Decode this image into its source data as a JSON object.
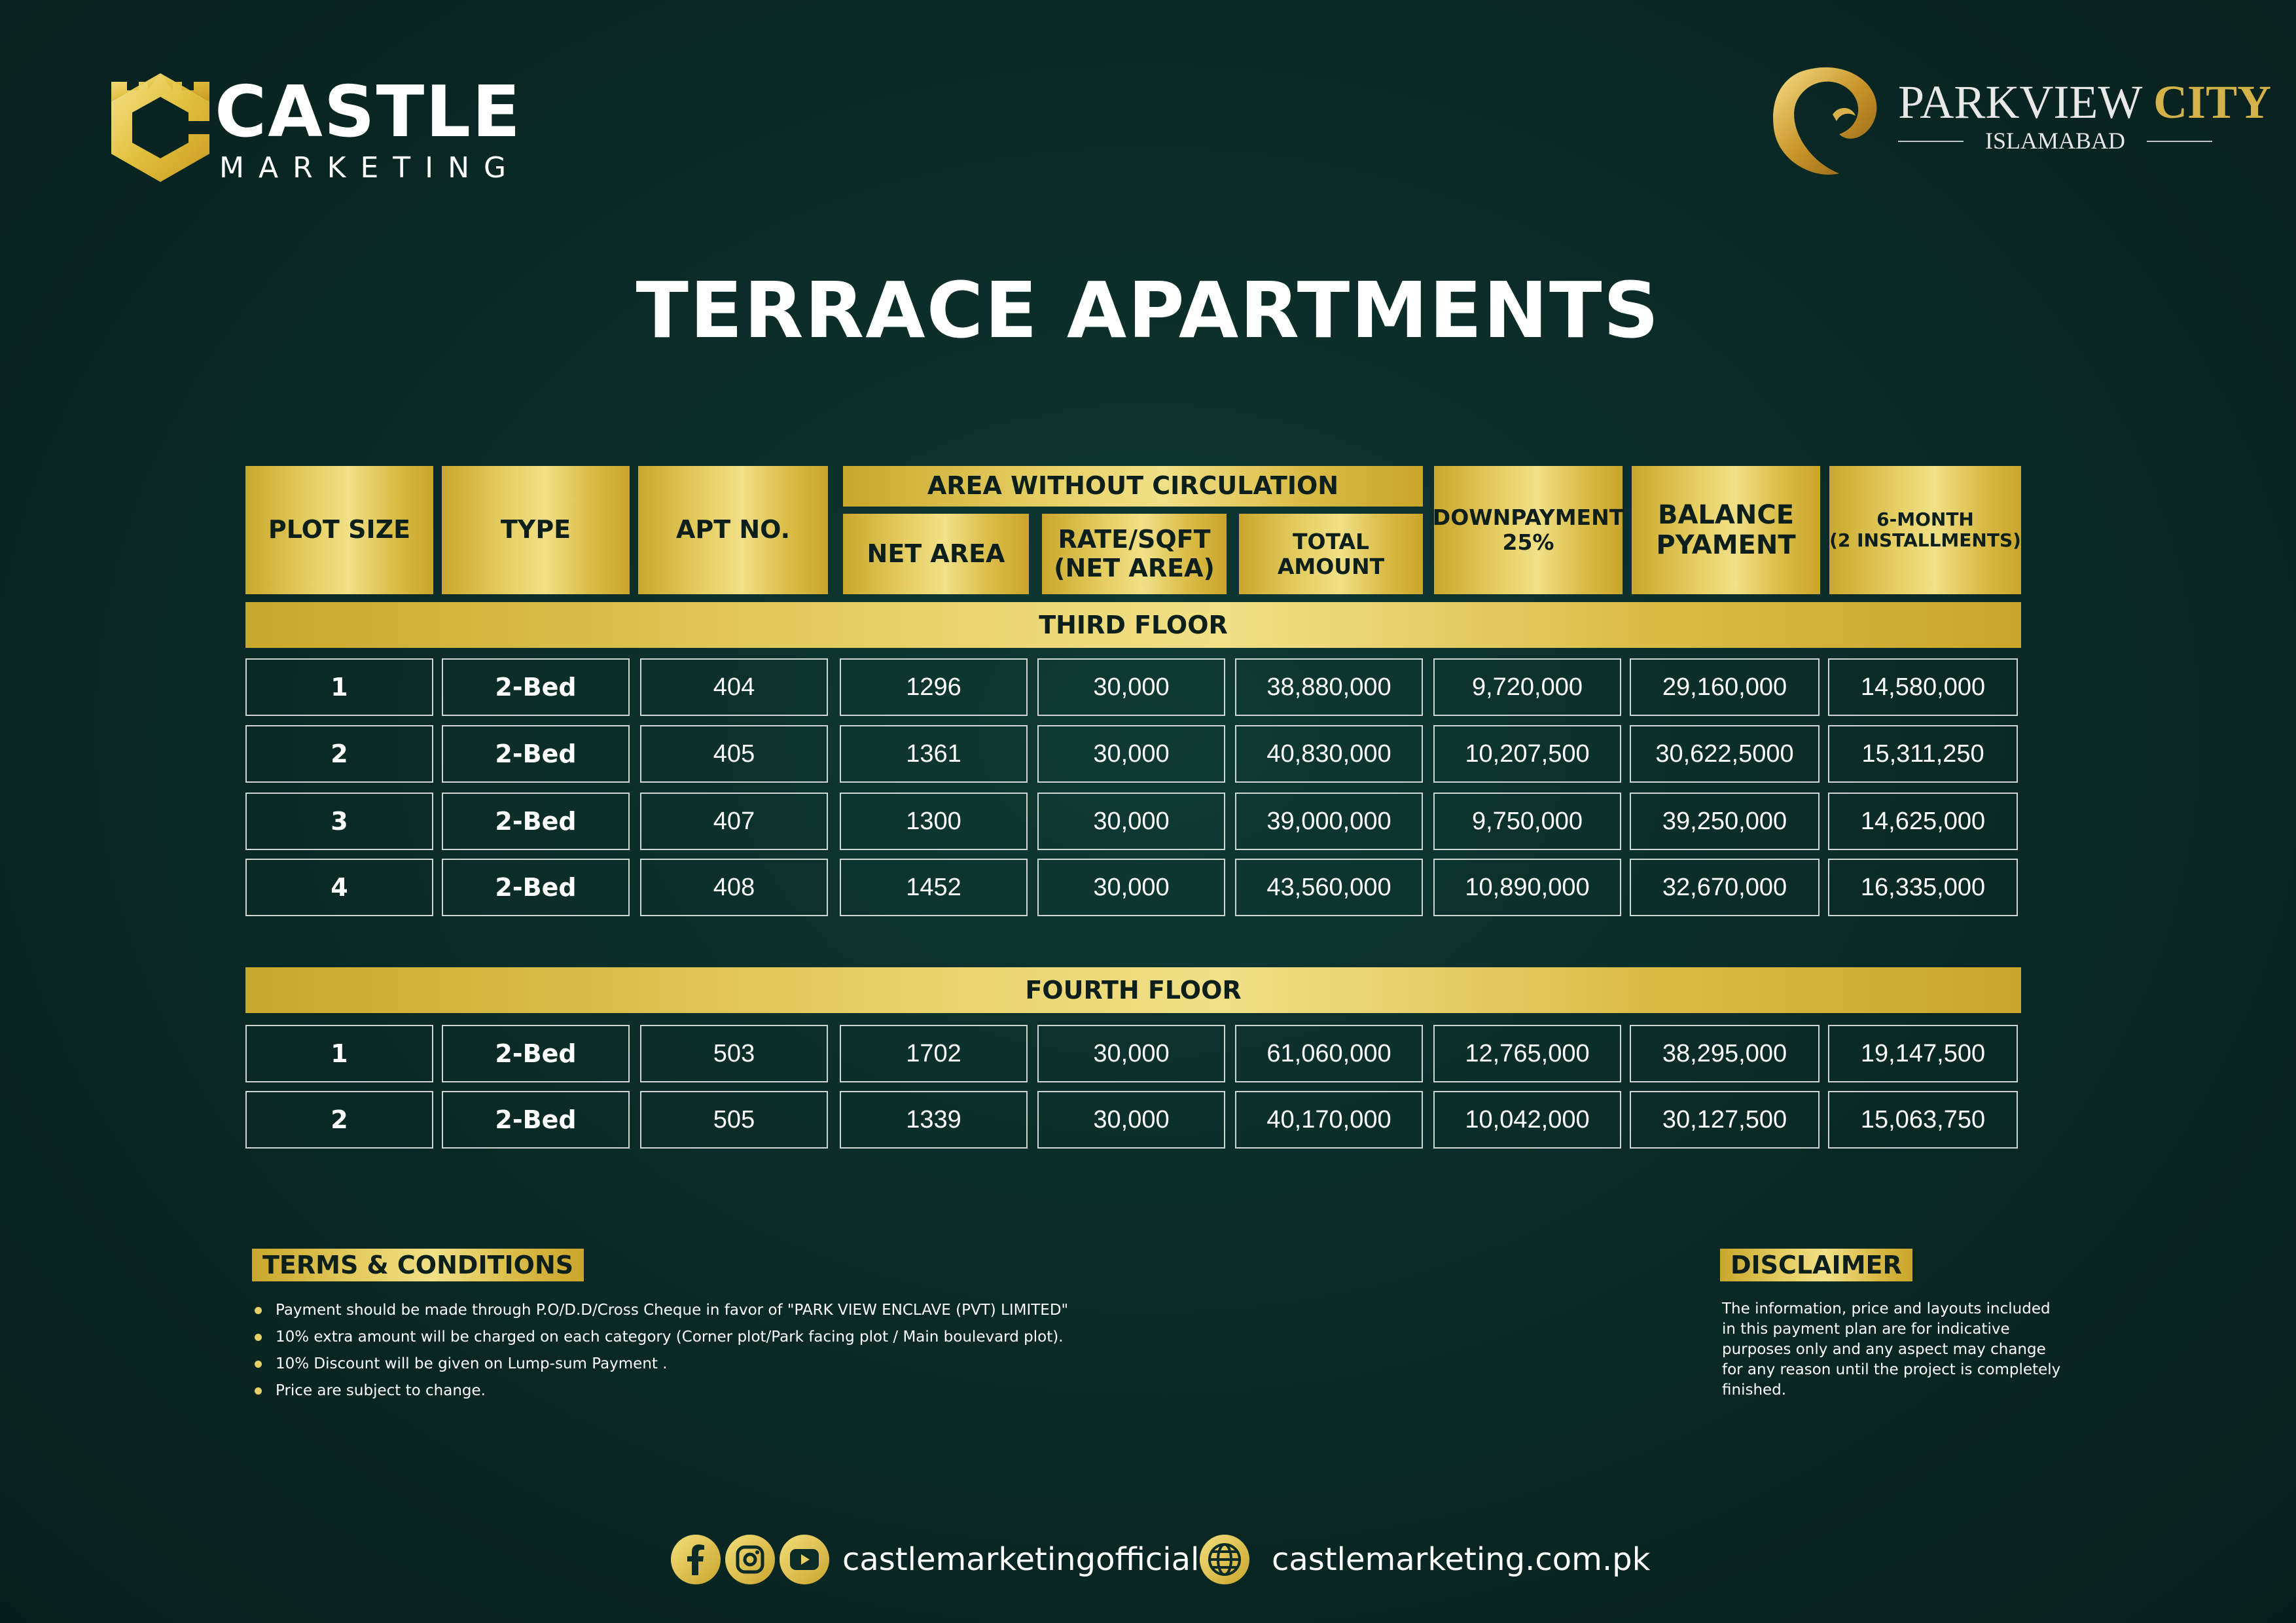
{
  "brand_left": {
    "name": "CASTLE",
    "sub": "MARKETING"
  },
  "brand_right": {
    "name_part1": "PARKVIEW",
    "name_part2": "CITY",
    "city": "ISLAMABAD"
  },
  "title": "TERRACE APARTMENTS",
  "colors": {
    "background": "#0b2b27",
    "gold": "#e6cf64",
    "gold_dark": "#c9a72c",
    "text": "#ffffff"
  },
  "table_header": {
    "plot_size": "PLOT SIZE",
    "type": "TYPE",
    "apt_no": "APT NO.",
    "area_group": "AREA WITHOUT CIRCULATION",
    "net_area": "NET AREA",
    "rate_line1": "RATE/SQFT",
    "rate_line2": "(NET AREA)",
    "total_amount": "TOTAL AMOUNT",
    "downpayment_line1": "DOWNPAYMENT",
    "downpayment_line2": "25%",
    "balance_line1": "BALANCE",
    "balance_line2": "PYAMENT",
    "six_month_line1": "6-MONTH",
    "six_month_line2": "(2 INSTALLMENTS)"
  },
  "sections": [
    {
      "label": "THIRD FLOOR",
      "rows": [
        {
          "plot": "1",
          "type": "2-Bed",
          "apt": "404",
          "net_area": "1296",
          "rate": "30,000",
          "total": "38,880,000",
          "down": "9,720,000",
          "balance": "29,160,000",
          "six_month": "14,580,000"
        },
        {
          "plot": "2",
          "type": "2-Bed",
          "apt": "405",
          "net_area": "1361",
          "rate": "30,000",
          "total": "40,830,000",
          "down": "10,207,500",
          "balance": "30,622,5000",
          "six_month": "15,311,250"
        },
        {
          "plot": "3",
          "type": "2-Bed",
          "apt": "407",
          "net_area": "1300",
          "rate": "30,000",
          "total": "39,000,000",
          "down": "9,750,000",
          "balance": "39,250,000",
          "six_month": "14,625,000"
        },
        {
          "plot": "4",
          "type": "2-Bed",
          "apt": "408",
          "net_area": "1452",
          "rate": "30,000",
          "total": "43,560,000",
          "down": "10,890,000",
          "balance": "32,670,000",
          "six_month": "16,335,000"
        }
      ]
    },
    {
      "label": "FOURTH FLOOR",
      "rows": [
        {
          "plot": "1",
          "type": "2-Bed",
          "apt": "503",
          "net_area": "1702",
          "rate": "30,000",
          "total": "61,060,000",
          "down": "12,765,000",
          "balance": "38,295,000",
          "six_month": "19,147,500"
        },
        {
          "plot": "2",
          "type": "2-Bed",
          "apt": "505",
          "net_area": "1339",
          "rate": "30,000",
          "total": "40,170,000",
          "down": "10,042,000",
          "balance": "30,127,500",
          "six_month": "15,063,750"
        }
      ]
    }
  ],
  "terms": {
    "heading": "TERMS & CONDITIONS",
    "items": [
      "Payment should be made through P.O/D.D/Cross Cheque in favor of \"PARK VIEW ENCLAVE (PVT) LIMITED\"",
      "10% extra amount will be charged on each category (Corner plot/Park facing plot / Main boulevard plot).",
      "10% Discount will be given on Lump-sum Payment .",
      "Price are subject to change."
    ]
  },
  "disclaimer": {
    "heading": "DISCLAIMER",
    "text": "The information, price and layouts included in this payment plan are for indicative purposes only and any aspect may change for any reason until the project is completely finished."
  },
  "footer": {
    "social_handle": "castlemarketingofficial",
    "website": "castlemarketing.com.pk",
    "icons": [
      "facebook-icon",
      "instagram-icon",
      "youtube-icon",
      "globe-icon"
    ]
  }
}
